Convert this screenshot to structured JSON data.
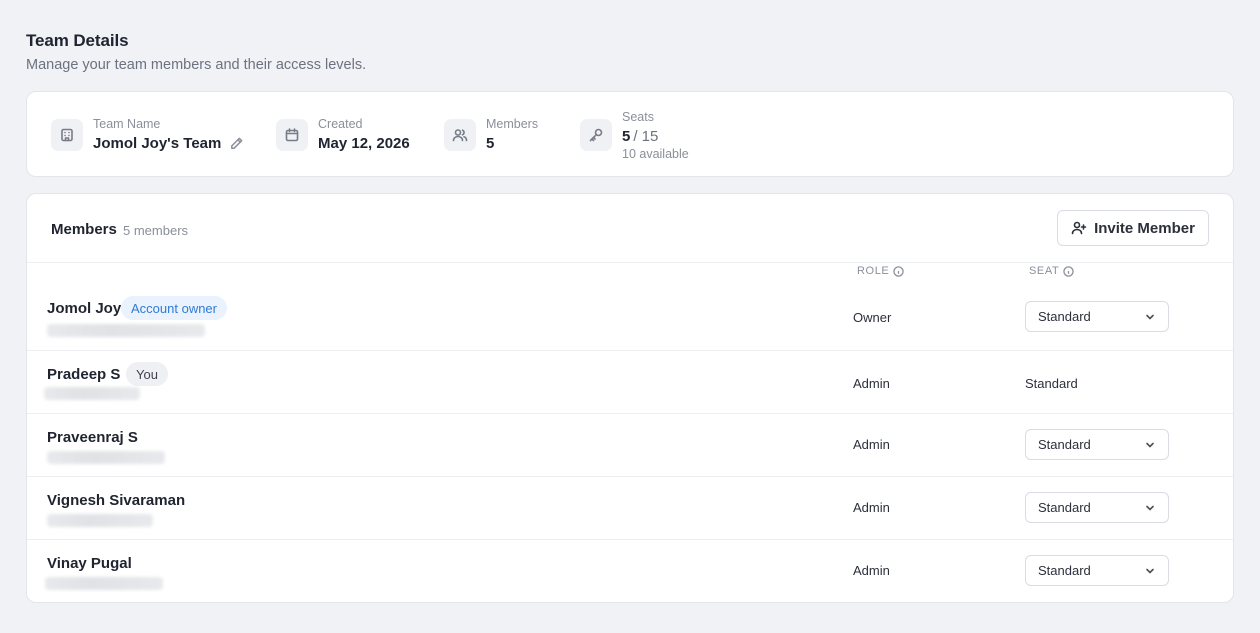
{
  "header": {
    "title": "Team Details",
    "subtitle": "Manage your team members and their access levels."
  },
  "summary": {
    "team_name": {
      "label": "Team Name",
      "value": "Jomol Joy's Team",
      "icon": "building-icon"
    },
    "created": {
      "label": "Created",
      "value": "May 12, 2026",
      "icon": "calendar-icon"
    },
    "members": {
      "label": "Members",
      "value": "5",
      "icon": "users-icon"
    },
    "seats": {
      "label": "Seats",
      "used": "5",
      "total": "/ 15",
      "available": "10 available",
      "icon": "key-icon"
    }
  },
  "members_section": {
    "title": "Members",
    "count": "5 members",
    "invite_label": "Invite Member",
    "columns": {
      "role": "ROLE",
      "seat": "SEAT"
    },
    "rows": [
      {
        "name": "Jomol Joy",
        "badge": "Account owner",
        "role": "Owner",
        "seat": "Standard",
        "seat_editable": true
      },
      {
        "name": "Pradeep S",
        "badge": "You",
        "role": "Admin",
        "seat": "Standard",
        "seat_editable": false
      },
      {
        "name": "Praveenraj S",
        "badge": "",
        "role": "Admin",
        "seat": "Standard",
        "seat_editable": true
      },
      {
        "name": "Vignesh Sivaraman",
        "badge": "",
        "role": "Admin",
        "seat": "Standard",
        "seat_editable": true
      },
      {
        "name": "Vinay Pugal",
        "badge": "",
        "role": "Admin",
        "seat": "Standard",
        "seat_editable": true
      }
    ]
  },
  "colors": {
    "background": "#f1f2f5",
    "card": "#ffffff",
    "owner_badge_bg": "#eaf2fd",
    "owner_badge_text": "#2f7bd6"
  }
}
